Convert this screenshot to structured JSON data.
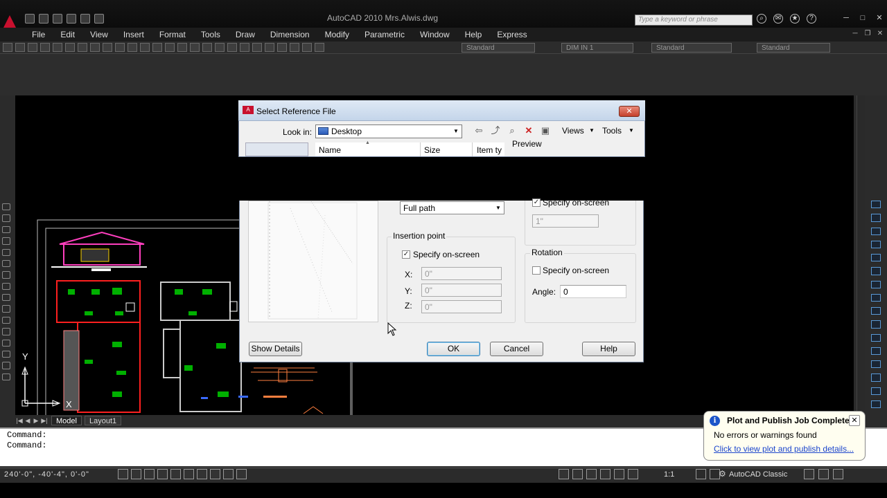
{
  "app": {
    "title": "AutoCAD 2010    Mrs.Alwis.dwg",
    "search_placeholder": "Type a keyword or phrase"
  },
  "menu": [
    "File",
    "Edit",
    "View",
    "Insert",
    "Format",
    "Tools",
    "Draw",
    "Dimension",
    "Modify",
    "Parametric",
    "Window",
    "Help",
    "Express"
  ],
  "toolbar": {
    "text_style": "Standard",
    "dim_style": "DIM IN 1",
    "table_style": "Standard",
    "mleader_style": "Standard"
  },
  "axis": {
    "y_label": "Y",
    "x_label": "X"
  },
  "tabs": {
    "model": "Model",
    "layout1": "Layout1"
  },
  "command": {
    "line1": "Command:",
    "line2": "Command:"
  },
  "status": {
    "coordinates": "240'-0\",   -40'-4\",   0'-0\"",
    "annotation_scale": "1:1",
    "workspace": "AutoCAD Classic"
  },
  "dialog": {
    "title": "Select Reference File",
    "logo_text": "A",
    "look_in_label": "Look in:",
    "look_in_value": "Desktop",
    "views_label": "Views",
    "tools_label": "Tools",
    "preview_label": "Preview",
    "columns": {
      "name": "Name",
      "size": "Size",
      "type": "Item ty"
    },
    "path_type": "Full path",
    "insertion_point": {
      "title": "Insertion point",
      "specify_on_screen": "Specify on-screen",
      "specify_checked": true,
      "x_label": "X:",
      "x_value": "0\"",
      "y_label": "Y:",
      "y_value": "0\"",
      "z_label": "Z:",
      "z_value": "0\""
    },
    "scale": {
      "specify_on_screen": "Specify on-screen",
      "specify_checked": true,
      "value": "1\""
    },
    "rotation": {
      "title": "Rotation",
      "specify_on_screen": "Specify on-screen",
      "specify_checked": false,
      "angle_label": "Angle:",
      "angle_value": "0"
    },
    "buttons": {
      "show_details": "Show Details",
      "ok": "OK",
      "cancel": "Cancel",
      "help": "Help"
    }
  },
  "notification": {
    "title": "Plot and Publish Job Complete",
    "message": "No errors or warnings found",
    "link": "Click to view plot and publish details..."
  },
  "colors": {
    "drawing_bg": "#000000",
    "command_bg": "#ffffff",
    "link": "#1a44cc",
    "balloon_bg": "#fffef0",
    "info_blue": "#1c55c9"
  }
}
